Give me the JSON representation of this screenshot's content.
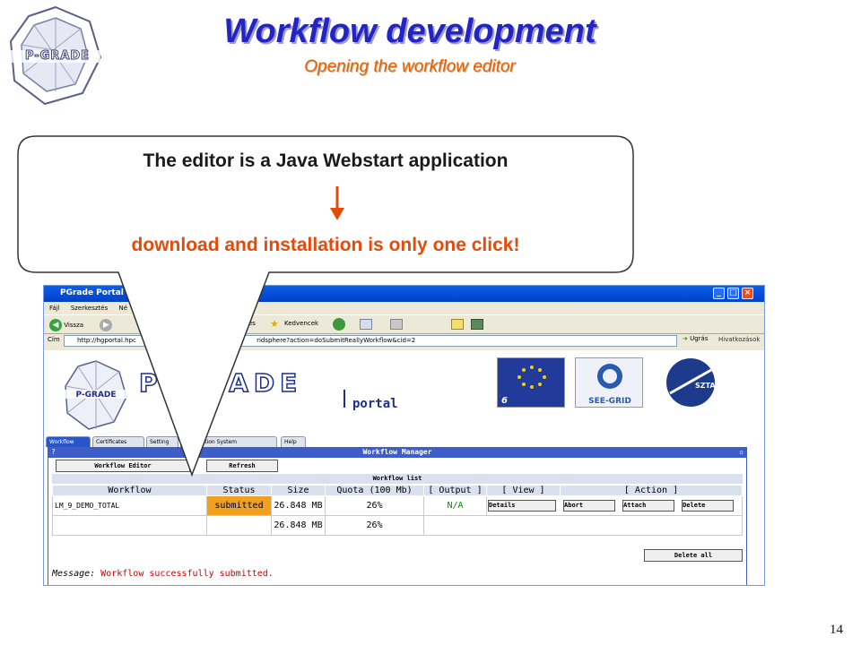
{
  "slide": {
    "title": "Workflow development",
    "subtitle": "Opening the workflow editor",
    "page_number": "14",
    "logo_text": "P-GRADE"
  },
  "callout": {
    "line1": "The editor is a Java Webstart application",
    "line2": "download and installation is only one click!",
    "arrow_color": "#e54a0a"
  },
  "browser": {
    "window_title": "PGrade Portal",
    "menu": [
      "Fájl",
      "Szerkesztés",
      "Né"
    ],
    "toolbar": {
      "back_label": "Vissza",
      "favorites_label": "Kedvencek",
      "search_fragment": "és"
    },
    "address": {
      "label": "Cím",
      "url_start": "http://hgportal.hpc",
      "url_end": "ridsphere?action=doSubmitReallyWorkflow&cid=2",
      "go_label": "Ugrás",
      "links_label": "Hivatkozások"
    }
  },
  "portal": {
    "brand": "P-GRADE",
    "brand_sub": "portal",
    "partners": [
      "EU",
      "SEE-GRID",
      "SZTAKI"
    ],
    "tabs": [
      "Workflow",
      "Certificates",
      "Setting",
      "Information System",
      "Help"
    ],
    "workflow_manager": {
      "header": "Workflow Manager",
      "editor_button": "Workflow Editor",
      "refresh_button": "Refresh",
      "list_label": "Workflow list",
      "columns": [
        "Workflow",
        "Status",
        "Size",
        "Quota (100 Mb)",
        "[ Output ]",
        "[ View ]",
        "[ Action ]"
      ],
      "rows": [
        {
          "name": "LM_9_DEMO_TOTAL",
          "status": "submitted",
          "size": "26.848 MB",
          "quota": "26%",
          "output": "N/A",
          "actions": [
            "Details",
            "Abort",
            "Attach",
            "Delete"
          ]
        },
        {
          "name": "",
          "status": "",
          "size": "26.848 MB",
          "quota": "26%",
          "output": "",
          "actions": []
        }
      ],
      "delete_all_button": "Delete all",
      "message_label": "Message:",
      "message_text": "Workflow successfully submitted."
    }
  }
}
